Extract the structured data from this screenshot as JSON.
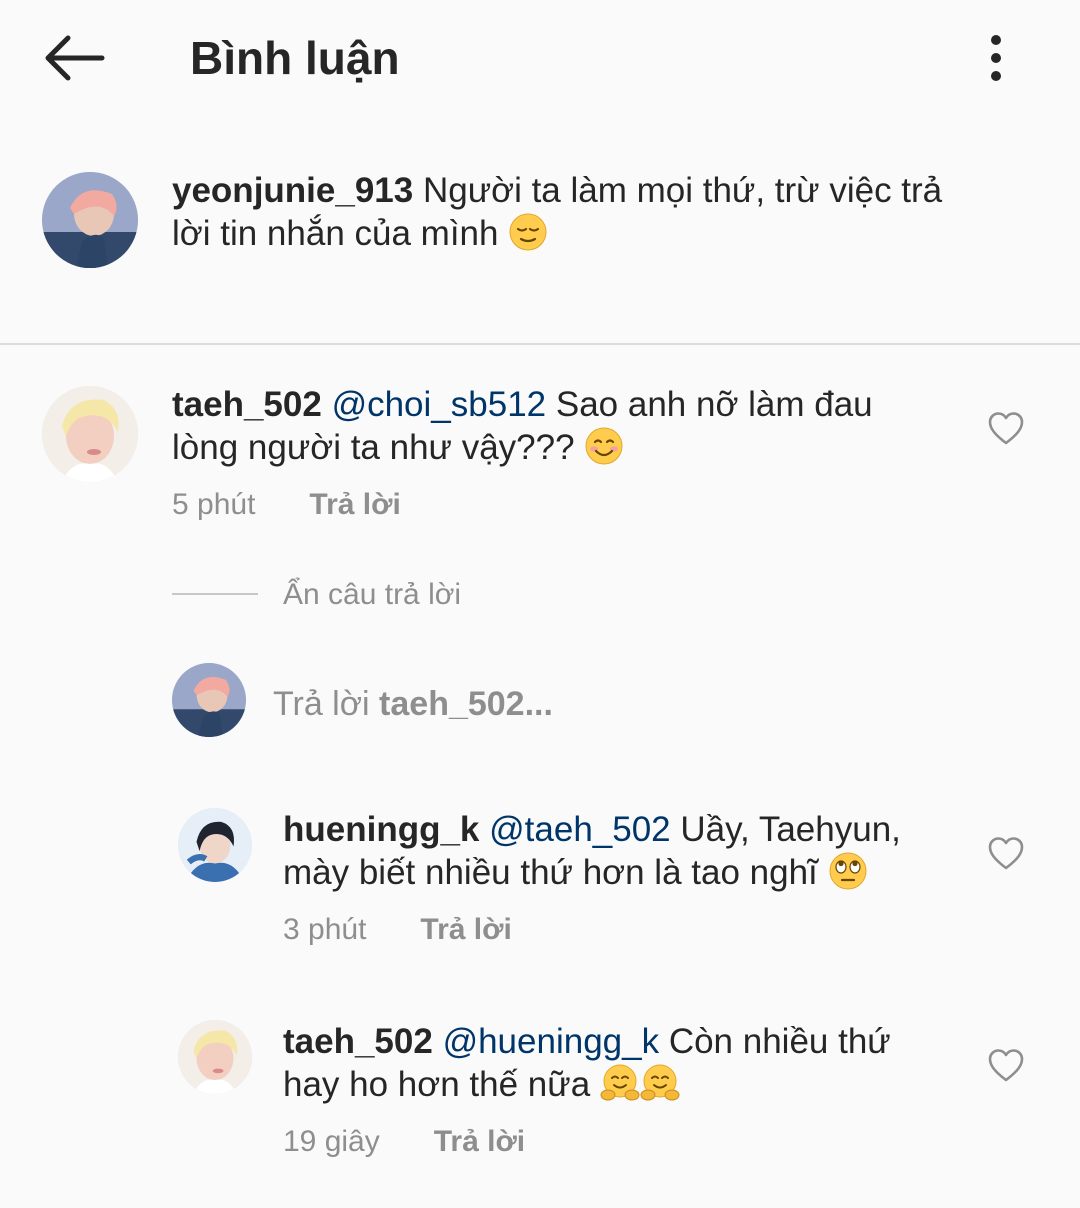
{
  "header": {
    "title": "Bình luận",
    "back_icon": "arrow-left-icon",
    "more_icon": "more-vertical-icon"
  },
  "caption": {
    "username": "yeonjunie_913",
    "text_line1": " Người ta làm mọi thứ, trừ việc trả",
    "text_line2": "lời tin nhắn của mình ",
    "emoji": "relieved-face-emoji"
  },
  "comments": [
    {
      "username": "taeh_502",
      "mention": "@choi_sb512",
      "text_line1": " Sao anh nỡ làm đau",
      "text_line2": "lòng người ta như vậy??? ",
      "emoji": "smiling-face-emoji",
      "time": "5 phút",
      "reply_label": "Trả lời"
    }
  ],
  "hide_replies": "Ẩn câu trả lời",
  "reply_box": {
    "prefix": "Trả lời ",
    "target": "taeh_502...",
    "placeholder": "Trả lời taeh_502..."
  },
  "replies": [
    {
      "username": "hueningg_k",
      "mention": "@taeh_502",
      "text_line1": " Uầy, Taehyun,",
      "text_line2": "mày biết nhiều thứ hơn là tao nghĩ ",
      "emoji": "eye-roll-emoji",
      "time": "3 phút",
      "reply_label": "Trả lời"
    },
    {
      "username": "taeh_502",
      "mention": "@hueningg_k",
      "text_line1": " Còn nhiều thứ",
      "text_line2": "hay ho hơn thế nữa ",
      "emoji": "hugging-face-emoji",
      "time": "19 giây",
      "reply_label": "Trả lời"
    }
  ],
  "colors": {
    "background": "#fafafa",
    "text": "#262626",
    "secondary": "#8e8e8e",
    "mention": "#003569",
    "divider": "#dbdbdb"
  }
}
